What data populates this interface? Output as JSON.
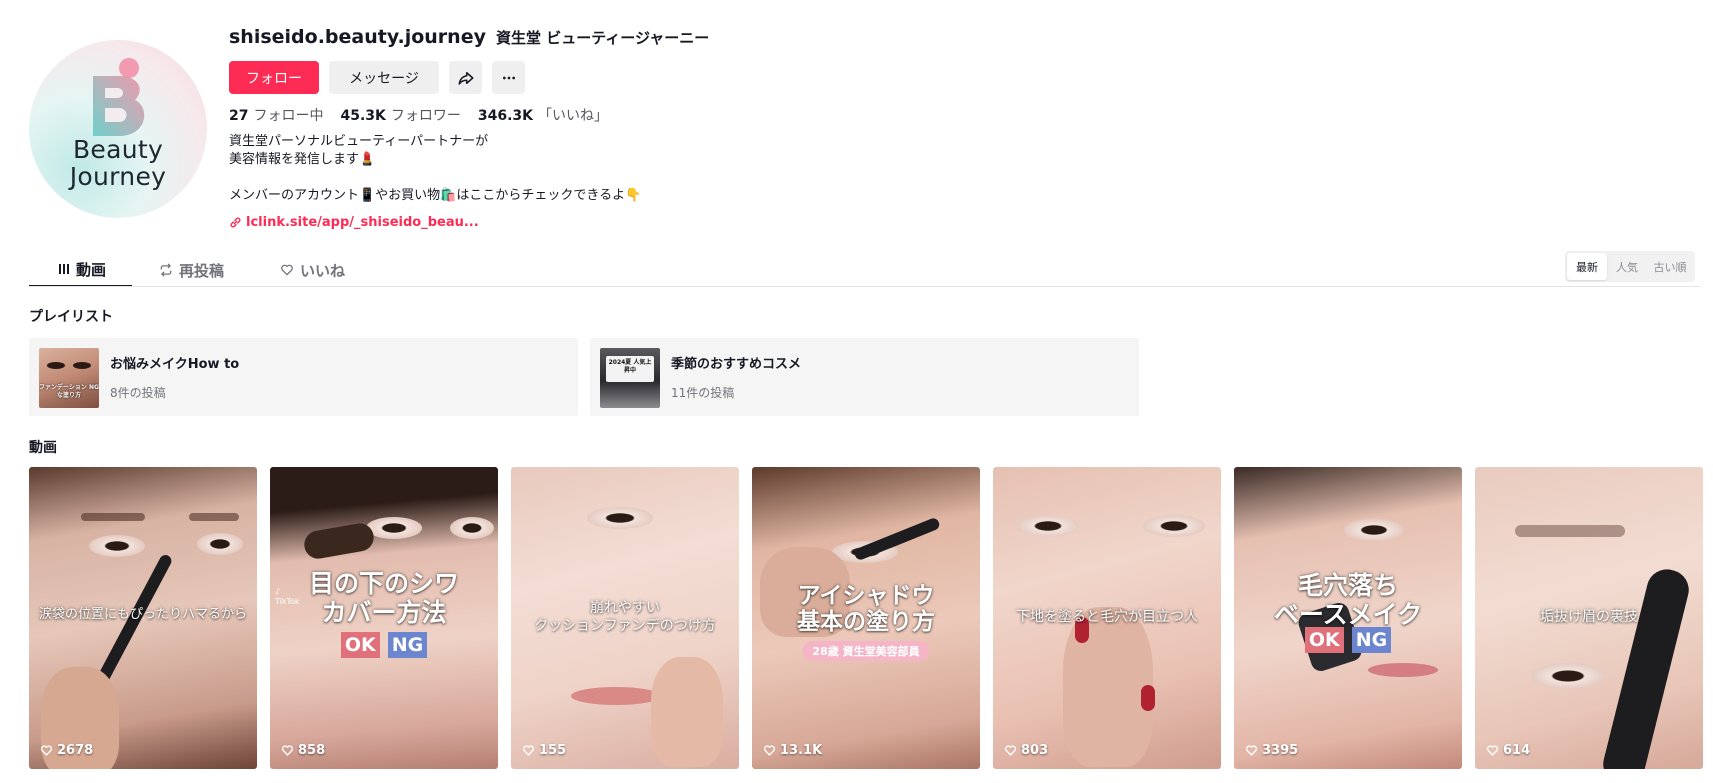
{
  "profile": {
    "username": "shiseido.beauty.journey",
    "nickname": "資生堂 ビューティージャーニー",
    "avatar_text": [
      "Beauty",
      "Journey"
    ],
    "follow_label": "フォロー",
    "message_label": "メッセージ",
    "share_icon": "share-icon",
    "more_icon": "more-dots-icon",
    "stats": {
      "following_count": "27",
      "following_label": "フォロー中",
      "followers_count": "45.3K",
      "followers_label": "フォロワー",
      "likes_count": "346.3K",
      "likes_label": "「いいね」"
    },
    "bio_line1": "資生堂パーソナルビューティーパートナーが",
    "bio_line2": "美容情報を発信します💄",
    "bio_line3": "メンバーのアカウント📱やお買い物🛍️はここからチェックできるよ👇",
    "link_text": "lclink.site/app/_shiseido_beau..."
  },
  "tabs": {
    "videos": "動画",
    "reposts": "再投稿",
    "likes": "いいね"
  },
  "sort": {
    "latest": "最新",
    "popular": "人気",
    "oldest": "古い順"
  },
  "playlists_title": "プレイリスト",
  "playlists": [
    {
      "title": "お悩みメイクHow to",
      "count": "8件の投稿",
      "thumb_text": "ファンデーション NGな塗り方"
    },
    {
      "title": "季節のおすすめコスメ",
      "count": "11件の投稿",
      "thumb_text": "2024夏 人気上昇中"
    }
  ],
  "videos_title": "動画",
  "videos": [
    {
      "caption": "涙袋の位置にもぴったりハマるから",
      "views": "2678"
    },
    {
      "caption_line1": "目の下のシワ",
      "caption_line2": "カバー方法",
      "ok": "OK",
      "ng": "NG",
      "views": "858"
    },
    {
      "caption_line1": "崩れやすい",
      "caption_line2": "クッションファンデのつけ方",
      "views": "155"
    },
    {
      "caption_line1": "アイシャドウ",
      "caption_line2": "基本の塗り方",
      "pill": "28歳 資生堂美容部員",
      "views": "13.1K"
    },
    {
      "caption": "下地を塗ると毛穴が目立つ人",
      "views": "803"
    },
    {
      "caption_line1": "毛穴落ち",
      "caption_line2": "ベースメイク",
      "ok": "OK",
      "ng": "NG",
      "views": "3395"
    },
    {
      "caption": "垢抜け眉の裏技",
      "views": "614"
    }
  ],
  "colors": {
    "brand": "#fe2c55",
    "text": "#161823",
    "muted": "#73747b"
  }
}
